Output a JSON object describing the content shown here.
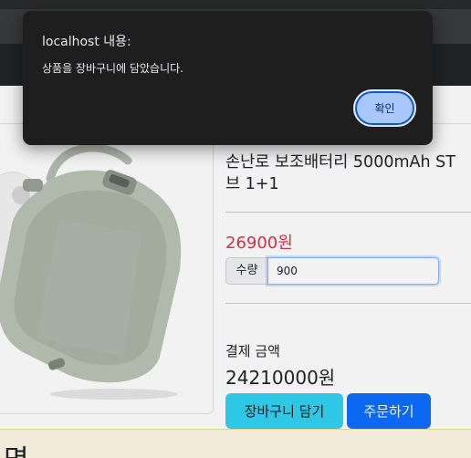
{
  "product": {
    "title_line1": "손난로 보조배터리 5000mAh ST",
    "title_line2": "브 1+1",
    "price": "26900원",
    "quantity_label": "수량",
    "quantity_value": "900",
    "total_label": "결제 금액",
    "total_value": "24210000원",
    "add_to_cart_label": "장바구니 담기",
    "order_label": "주문하기"
  },
  "footer": {
    "partial_text": "명"
  },
  "dialog": {
    "title": "localhost 내용:",
    "message": "상품을 장바구니에 담았습니다.",
    "ok_label": "확인"
  },
  "colors": {
    "price": "#dc3545",
    "cart_button": "#31d2f2",
    "order_button": "#0d6efd",
    "dialog_bg": "#1e1e1f",
    "dialog_button": "#a8c7fa"
  }
}
